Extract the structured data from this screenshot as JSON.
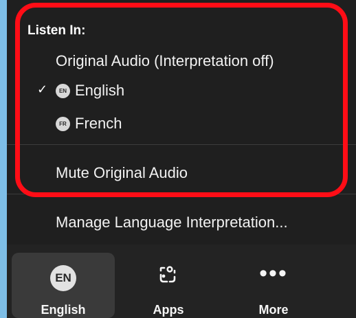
{
  "interpretation_menu": {
    "section_title": "Listen In:",
    "original_audio_label": "Original Audio (Interpretation off)",
    "languages": [
      {
        "code": "EN",
        "label": "English",
        "selected": true
      },
      {
        "code": "FR",
        "label": "French",
        "selected": false
      }
    ],
    "selected_mark": "✓",
    "mute_original_audio_label": "Mute Original Audio",
    "manage_language_interpretation_label": "Manage Language Interpretation..."
  },
  "toolbar": {
    "language_button": {
      "badge": "EN",
      "label": "English"
    },
    "apps_button": {
      "label": "Apps",
      "icon": "apps-icon"
    },
    "more_button": {
      "label": "More",
      "icon": "more-dots-icon"
    }
  },
  "colors": {
    "background": "#7ebee6",
    "panel": "#232323",
    "highlight": "#ff0d16",
    "text": "#f2f2f2"
  }
}
